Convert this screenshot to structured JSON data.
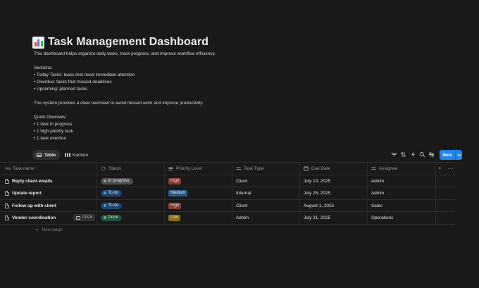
{
  "page": {
    "title": "Task Management Dashboard",
    "title_icon": "bar-chart-icon",
    "description": [
      "This dashboard helps organize daily tasks, track progress, and improve workflow efficiency.",
      "",
      "Sections:",
      "• Today Tasks: tasks that need immediate attention",
      "• Overdue: tasks that missed deadlines",
      "• Upcoming: planned tasks",
      "",
      "The system provides a clear overview to avoid missed work and improve productivity.",
      "",
      "Quick Overview:",
      "• 1 task in progress",
      "• 1 high priority task",
      "• 1 task overdue"
    ]
  },
  "views": {
    "tabs": [
      {
        "label": "Table",
        "icon": "table-icon",
        "active": true
      },
      {
        "label": "Kanban",
        "icon": "kanban-icon",
        "active": false
      }
    ],
    "toolbar_icons": [
      "filter-icon",
      "sort-icon",
      "automation-icon",
      "search-icon",
      "settings-icon"
    ],
    "new_label": "New"
  },
  "table": {
    "columns": [
      {
        "label": "Task name",
        "icon": "text-icon"
      },
      {
        "label": "Status",
        "icon": "status-icon"
      },
      {
        "label": "Priority Level",
        "icon": "list-icon"
      },
      {
        "label": "Task Type",
        "icon": "select-icon"
      },
      {
        "label": "Due Date",
        "icon": "calendar-icon"
      },
      {
        "label": "Assignee",
        "icon": "select-icon"
      }
    ],
    "rows": [
      {
        "name": "Reply client emails",
        "status": "In progress",
        "priority": "High",
        "type": "Client",
        "due": "July 10, 2025",
        "assignee": "Admin"
      },
      {
        "name": "Update report",
        "status": "To do",
        "priority": "Medium",
        "type": "Internal",
        "due": "July 25, 2025",
        "assignee": "Admin"
      },
      {
        "name": "Follow up with client",
        "status": "To do",
        "priority": "High",
        "type": "Client",
        "due": "August 1, 2025",
        "assignee": "Sales"
      },
      {
        "name": "Vendor coordination",
        "status": "Done",
        "priority": "Low",
        "type": "Admin",
        "due": "July 31, 2025",
        "assignee": "Operations"
      }
    ],
    "open_label": "OPEN",
    "new_page_label": "New page"
  },
  "colors": {
    "status": {
      "In progress": {
        "bg": "#4e4e4e",
        "dot": "#9b9b9b",
        "fg": "#e6e6e6"
      },
      "To do": {
        "bg": "#1e4470",
        "dot": "#4a97e8",
        "fg": "#dbe9f8"
      },
      "Done": {
        "bg": "#24503a",
        "dot": "#4fbf7f",
        "fg": "#d8efe2"
      }
    },
    "priority": {
      "High": {
        "bg": "#8a3a35",
        "fg": "#f3dad7"
      },
      "Medium": {
        "bg": "#2a5b86",
        "fg": "#dbe9f8"
      },
      "Low": {
        "bg": "#8a6a1e",
        "fg": "#f4e8c8"
      }
    },
    "accent": "#2383e2"
  }
}
